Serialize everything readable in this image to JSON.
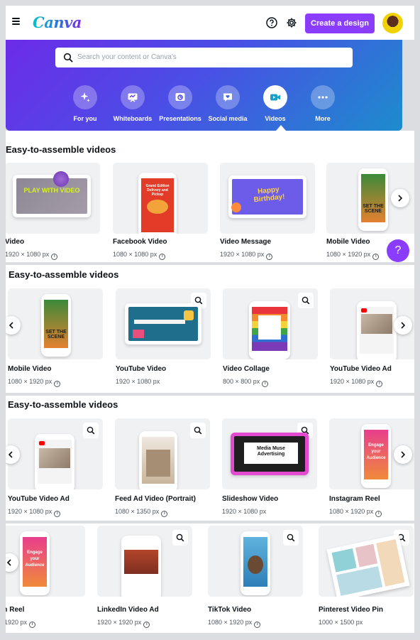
{
  "header": {
    "logo": "Canva",
    "create_label": "Create a design"
  },
  "search": {
    "placeholder": "Search your content or Canva's"
  },
  "categories": [
    {
      "label": "For you",
      "icon": "sparkle-icon"
    },
    {
      "label": "Whiteboards",
      "icon": "whiteboard-icon"
    },
    {
      "label": "Presentations",
      "icon": "presentation-icon"
    },
    {
      "label": "Social media",
      "icon": "heart-chat-icon"
    },
    {
      "label": "Videos",
      "icon": "video-camera-icon",
      "active": true
    },
    {
      "label": "More",
      "icon": "more-dots-icon"
    }
  ],
  "sections": [
    {
      "title": "Easy-to-assemble videos",
      "cards": [
        {
          "name": "Video",
          "size": "1920 × 1080 px",
          "info": true,
          "art_text": "PLAY WITH VIDEO"
        },
        {
          "name": "Facebook Video",
          "size": "1080 × 1080 px",
          "info": true,
          "art_text": "Grand Edition Delivery and Pickup"
        },
        {
          "name": "Video Message",
          "size": "1920 × 1080 px",
          "info": true,
          "art_text": "Happy Birthday!"
        },
        {
          "name": "Mobile Video",
          "size": "1080 × 1920 px",
          "info": true,
          "art_text": "SET THE SCENE"
        }
      ]
    },
    {
      "title": "Easy-to-assemble videos",
      "cards": [
        {
          "name": "Mobile Video",
          "size": "1080 × 1920 px",
          "info": true,
          "art_text": "SET THE SCENE"
        },
        {
          "name": "YouTube Video",
          "size": "1920 × 1080 px",
          "info": false,
          "art_text": ""
        },
        {
          "name": "Video Collage",
          "size": "800 × 800 px",
          "info": true,
          "art_text": ""
        },
        {
          "name": "YouTube Video Ad",
          "size": "1920 × 1080 px",
          "info": true,
          "art_text": ""
        }
      ]
    },
    {
      "title": "Easy-to-assemble videos",
      "cards": [
        {
          "name": "YouTube Video Ad",
          "size": "1920 × 1080 px",
          "info": true,
          "art_text": ""
        },
        {
          "name": "Feed Ad Video (Portrait)",
          "size": "1080 × 1350 px",
          "info": true,
          "art_text": ""
        },
        {
          "name": "Slideshow Video",
          "size": "1920 × 1080 px",
          "info": false,
          "art_text": "Media Muse Advertising"
        },
        {
          "name": "Instagram Reel",
          "size": "1080 × 1920 px",
          "info": true,
          "art_text": "Engage your Audience"
        }
      ]
    },
    {
      "title": "",
      "cards": [
        {
          "name": "gram Reel",
          "size": "1920 px",
          "info": true,
          "art_text": "Engage your Audience"
        },
        {
          "name": "LinkedIn Video Ad",
          "size": "1920 × 1920 px",
          "info": true,
          "art_text": ""
        },
        {
          "name": "TikTok Video",
          "size": "1080 × 1920 px",
          "info": true,
          "art_text": ""
        },
        {
          "name": "Pinterest Video Pin",
          "size": "1000 × 1500 px",
          "info": false,
          "art_text": ""
        }
      ]
    }
  ],
  "help_fab": "?",
  "colors": {
    "brand": "#8b3dff",
    "accent_teal": "#00c4cc"
  }
}
